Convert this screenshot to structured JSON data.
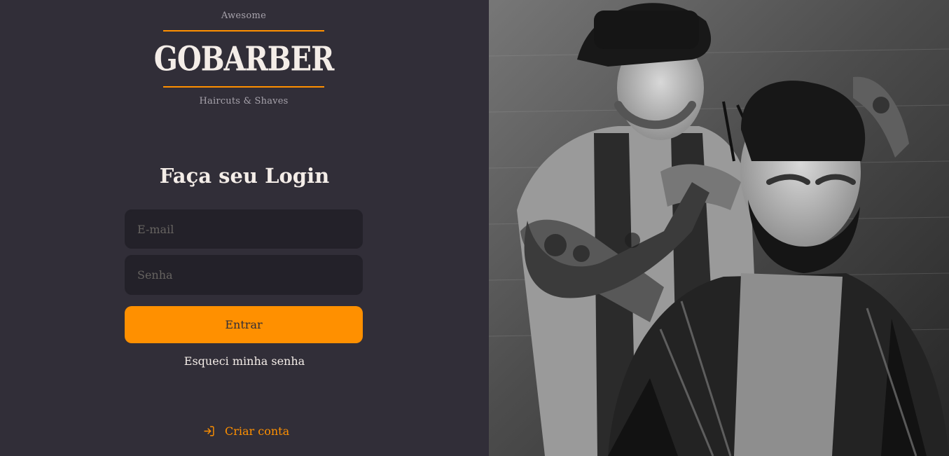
{
  "logo": {
    "top_text": "Awesome",
    "brand_name": "GOBARBER",
    "bottom_text": "Haircuts & Shaves"
  },
  "login": {
    "title": "Faça seu Login",
    "email_placeholder": "E-mail",
    "password_placeholder": "Senha",
    "submit_label": "Entrar",
    "forgot_label": "Esqueci minha senha"
  },
  "footer": {
    "create_account_label": "Criar conta",
    "create_account_icon": "log-in-icon"
  },
  "colors": {
    "background": "#312e38",
    "input_background": "#232129",
    "accent": "#ff9000",
    "text": "#f4ede8",
    "muted": "#a7a3ac",
    "placeholder": "#666360"
  },
  "hero": {
    "image_description_icon": "barber-photo"
  }
}
